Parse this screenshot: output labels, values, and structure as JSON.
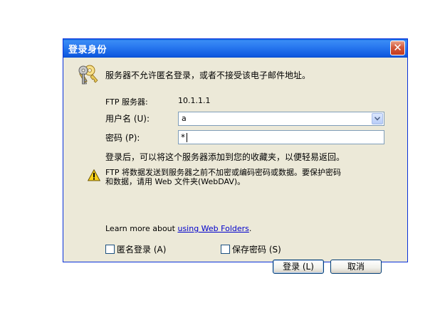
{
  "window": {
    "title": "登录身份",
    "close_glyph": "✕"
  },
  "intro": "服务器不允许匿名登录，或者不接受该电子邮件地址。",
  "ftp_server": {
    "label": "FTP 服务器:",
    "value": "10.1.1.1"
  },
  "username": {
    "label": "用户名 (U):",
    "value": "a"
  },
  "password": {
    "label": "密码 (P):",
    "value": "*"
  },
  "after_login_note": "登录后，可以将这个服务器添加到您的收藏夹，以便轻易返回。",
  "warning": "FTP 将数据发送到服务器之前不加密或编码密码或数据。要保护密码和数据，请用 Web 文件夹(WebDAV)。",
  "learn_more": {
    "prefix": "Learn more about ",
    "link": "using Web Folders",
    "suffix": "."
  },
  "checkboxes": {
    "anonymous": "匿名登录 (A)",
    "save_password": "保存密码 (S)"
  },
  "buttons": {
    "login": "登录 (L)",
    "cancel": "取消"
  },
  "colors": {
    "titlebar": "#0a5fe0",
    "dialog_bg": "#ece9d8",
    "link": "#0000cc",
    "close": "#c23b1f"
  },
  "icons": {
    "dialog": "keys-icon",
    "warning": "warning-icon",
    "dropdown": "chevron-down-icon"
  }
}
